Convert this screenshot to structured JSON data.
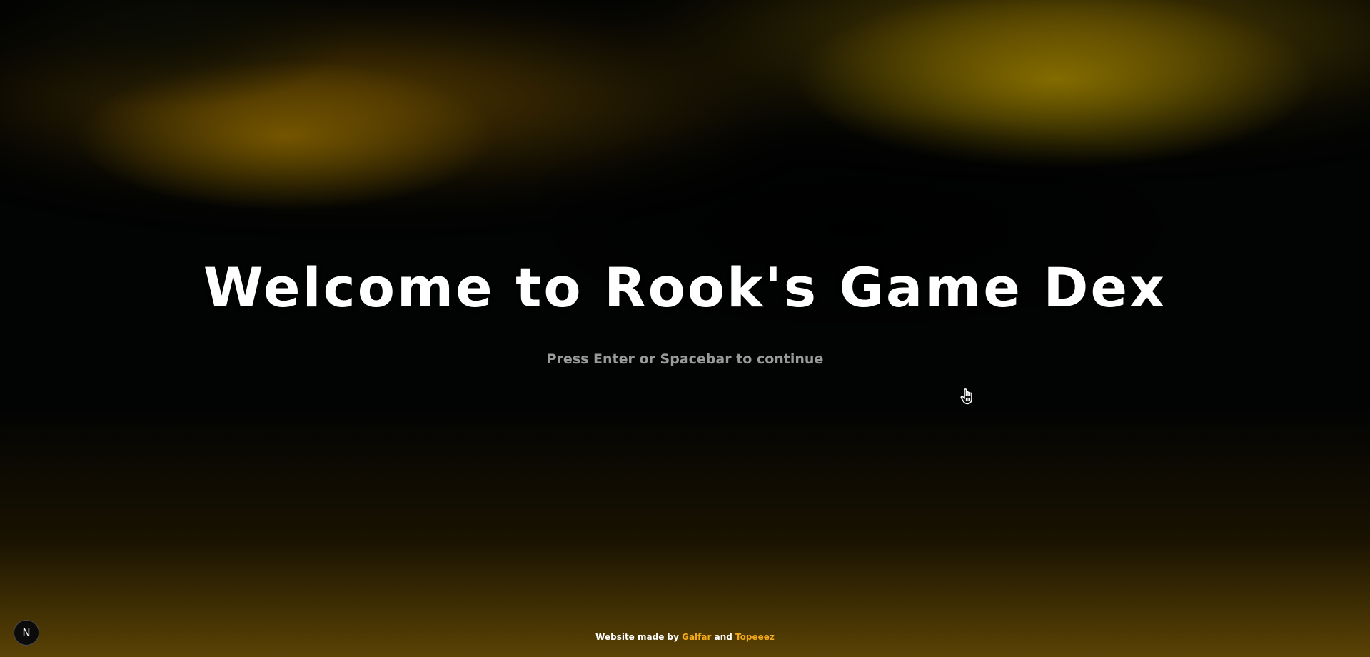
{
  "hero": {
    "title": "Welcome to Rook's Game Dex",
    "subtitle": "Press Enter or Spacebar to continue"
  },
  "footer": {
    "prefix": "Website made by",
    "author1": "Galfar",
    "connector": "and",
    "author2": "Topeeez"
  },
  "badge": {
    "letter": "N",
    "icon": "nextjs-logo-icon"
  },
  "cursor": {
    "icon": "hand-pointer-icon"
  },
  "colors": {
    "accent": "#f2a91c",
    "title": "#ffffff",
    "subtitle": "#9a9a9a",
    "glow": "#8a7200"
  }
}
